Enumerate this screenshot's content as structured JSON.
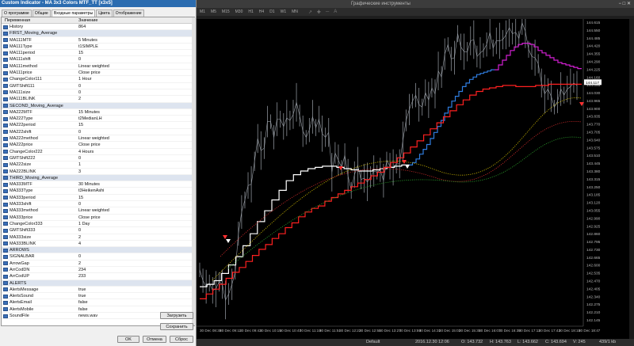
{
  "dialog": {
    "title": "Custom Indicator - MA 3x3 Colors MTF_TT [x3x5]",
    "tabs": [
      "О программе",
      "Общие",
      "Входные параметры",
      "Цвета",
      "Отображение"
    ],
    "active_tab": 2,
    "columns": {
      "name": "Переменная",
      "value": "Значение"
    },
    "params": [
      {
        "name": "History",
        "value": "864"
      },
      {
        "name": "FIRST_Moving_Average",
        "value": "",
        "sep": true
      },
      {
        "name": "MA111MTF",
        "value": "5 Minutes"
      },
      {
        "name": "MA111Type",
        "value": "t1SIMPLE"
      },
      {
        "name": "MA111period",
        "value": "15"
      },
      {
        "name": "MA111shift",
        "value": "0"
      },
      {
        "name": "MA111method",
        "value": "Linear weighted"
      },
      {
        "name": "MA111price",
        "value": "Close price"
      },
      {
        "name": "ChangeColor111",
        "value": "1 Hour"
      },
      {
        "name": "GMTShift111",
        "value": "0"
      },
      {
        "name": "MA111size",
        "value": "0"
      },
      {
        "name": "MA111BLINK",
        "value": "2"
      },
      {
        "name": "SECOND_Moving_Average",
        "value": "",
        "sep": true
      },
      {
        "name": "MA222MTF",
        "value": "15 Minutes"
      },
      {
        "name": "MA222Type",
        "value": "t2MedianLH"
      },
      {
        "name": "MA222period",
        "value": "15"
      },
      {
        "name": "MA222shift",
        "value": "0"
      },
      {
        "name": "MA222method",
        "value": "Linear weighted"
      },
      {
        "name": "MA222price",
        "value": "Close price"
      },
      {
        "name": "ChangeColor222",
        "value": "4 Hours"
      },
      {
        "name": "GMTShift222",
        "value": "0"
      },
      {
        "name": "MA222size",
        "value": "1"
      },
      {
        "name": "MA222BLINK",
        "value": "3"
      },
      {
        "name": "THIRD_Moving_Average",
        "value": "",
        "sep": true
      },
      {
        "name": "MA333MTF",
        "value": "30 Minutes"
      },
      {
        "name": "MA333Type",
        "value": "t3HeikenAshi"
      },
      {
        "name": "MA333period",
        "value": "15"
      },
      {
        "name": "MA333shift",
        "value": "0"
      },
      {
        "name": "MA333method",
        "value": "Linear weighted"
      },
      {
        "name": "MA333price",
        "value": "Close price"
      },
      {
        "name": "ChangeColor333",
        "value": "1 Day"
      },
      {
        "name": "GMTShift333",
        "value": "0"
      },
      {
        "name": "MA333size",
        "value": "2"
      },
      {
        "name": "MA333BLINK",
        "value": "4"
      },
      {
        "name": "ARROWS",
        "value": "",
        "sep": true
      },
      {
        "name": "SIGNALBAR",
        "value": "0"
      },
      {
        "name": "ArrowGap",
        "value": "2"
      },
      {
        "name": "ArrCodDN",
        "value": "234"
      },
      {
        "name": "ArrCodUP",
        "value": "233"
      },
      {
        "name": "ALERTS",
        "value": "",
        "sep": true
      },
      {
        "name": "AlertsMessage",
        "value": "true"
      },
      {
        "name": "AlertsSound",
        "value": "true"
      },
      {
        "name": "AlertsEmail",
        "value": "false"
      },
      {
        "name": "AlertsMobile",
        "value": "false"
      },
      {
        "name": "SoundFile",
        "value": "news.wav"
      }
    ],
    "buttons": {
      "load": "Загрузить",
      "save": "Сохранить",
      "ok": "OK",
      "cancel": "Отмена",
      "reset": "Сброс"
    }
  },
  "window": {
    "title": "Графические инструменты",
    "timeframes": [
      "M1",
      "M5",
      "M15",
      "M30",
      "H1",
      "H4",
      "D1",
      "W1",
      "MN"
    ]
  },
  "chart_data": {
    "type": "line",
    "y_ticks": [
      "144.615",
      "144.550",
      "144.485",
      "144.420",
      "144.355",
      "144.290",
      "144.225",
      "144.160",
      "144.095",
      "144.030",
      "143.965",
      "143.900",
      "143.835",
      "143.770",
      "143.705",
      "143.640",
      "143.575",
      "143.510",
      "143.445",
      "143.380",
      "143.315",
      "143.250",
      "143.185",
      "143.120",
      "143.055",
      "142.990",
      "142.925",
      "142.860",
      "142.795",
      "142.730",
      "142.665",
      "142.600",
      "142.535",
      "142.470",
      "142.405",
      "142.340",
      "142.275",
      "142.210",
      "142.145"
    ],
    "price_label": "144.117",
    "x_ticks": [
      "30 Dec 08:39",
      "30 Dec 09:11",
      "30 Dec 09:43",
      "30 Dec 10:15",
      "30 Dec 10:47",
      "30 Dec 11:19",
      "30 Dec 11:51",
      "30 Dec 12:23",
      "30 Dec 12:55",
      "30 Dec 13:27",
      "30 Dec 13:59",
      "30 Dec 14:31",
      "30 Dec 15:03",
      "30 Dec 15:35",
      "30 Dec 16:07",
      "30 Dec 16:39",
      "30 Dec 17:11",
      "30 Dec 17:43",
      "30 Dec 18:15",
      "30 Dec 18:47"
    ],
    "price": [
      142.56,
      142.47,
      142.42,
      142.45,
      142.39,
      142.4,
      142.46,
      142.44,
      142.31,
      142.36,
      142.44,
      142.54,
      142.86,
      143.04,
      143.14,
      143.26,
      143.27,
      143.46,
      143.65,
      143.55,
      143.57,
      143.79,
      143.79,
      143.66,
      143.81,
      143.81,
      143.75,
      143.82,
      143.8,
      143.85,
      143.95,
      143.84,
      143.71,
      143.66,
      143.72,
      143.83,
      143.74,
      143.81,
      143.69,
      143.66,
      143.7,
      143.37,
      143.53,
      143.47,
      143.41,
      143.51,
      143.34,
      143.22,
      143.35,
      143.43,
      143.31,
      143.32,
      143.29,
      143.33,
      143.38,
      143.37,
      143.39,
      143.3,
      143.47,
      143.42,
      143.41,
      143.44,
      143.44,
      143.63,
      143.8,
      143.89,
      143.96,
      144.01,
      143.93,
      143.91,
      144.03,
      143.97,
      144.07,
      144.02,
      144.21,
      144.16,
      144.35,
      144.43,
      144.31,
      144.32,
      144.52,
      144.41,
      144.37,
      144.37,
      144.46,
      144.47,
      144.33,
      144.36,
      144.38,
      144.43,
      144.53,
      144.4,
      144.46,
      144.46,
      144.47,
      144.51,
      144.57,
      144.52,
      144.53,
      144.48,
      144.61,
      144.54,
      144.39,
      144.33,
      144.32,
      144.27,
      144.11,
      144.02,
      144.06,
      144.0,
      143.91,
      143.96,
      144.06,
      144.01,
      144.06,
      144.08,
      144.11,
      144.09
    ],
    "series": [
      {
        "color": "#ffffff",
        "line": "step",
        "values": [
          142.42,
          142.42,
          142.44,
          142.44,
          142.47,
          142.47,
          142.53,
          142.53,
          142.6,
          142.6,
          142.67,
          142.67,
          142.76,
          142.76,
          142.86,
          142.86,
          142.96,
          142.96,
          143.05,
          143.05,
          143.14,
          143.14,
          143.22,
          143.22,
          143.3,
          143.3,
          143.35,
          143.35,
          143.38,
          143.38,
          143.4,
          143.4,
          143.41,
          143.41,
          143.42,
          143.42,
          143.42,
          143.42,
          143.41,
          143.41,
          143.4,
          143.4,
          143.39,
          143.39,
          143.38,
          143.38,
          143.38,
          143.38,
          143.39,
          143.39,
          143.4,
          143.4,
          143.41,
          143.41,
          143.42,
          143.42,
          143.43,
          143.43
        ]
      },
      {
        "color": "#2f7de0",
        "line": "step",
        "values": [
          143.43,
          143.45,
          143.48,
          143.52,
          143.56,
          143.6,
          143.65,
          143.7,
          143.75,
          143.8,
          143.86,
          143.91,
          143.96,
          144.0,
          144.04,
          144.08,
          144.11,
          144.14,
          144.16,
          144.18,
          144.19,
          144.2,
          144.21,
          144.22
        ]
      },
      {
        "color": "#d21fd2",
        "line": "step",
        "values": [
          144.22,
          144.26,
          144.3,
          144.34,
          144.38,
          144.41,
          144.43,
          144.44,
          144.44,
          144.43,
          144.41,
          144.38,
          144.36,
          144.34,
          144.32,
          144.3,
          144.28,
          144.27,
          144.26,
          144.25,
          144.24,
          144.23
        ]
      },
      {
        "color": "#ff2020",
        "line": "step",
        "values": [
          142.32,
          142.36,
          142.4,
          142.44,
          142.49,
          142.54,
          142.58,
          142.63,
          142.68,
          142.73,
          142.77,
          142.82,
          142.86,
          142.91,
          142.95,
          143.0,
          143.04,
          143.07,
          143.09,
          143.13,
          143.16,
          143.19,
          143.22,
          143.25,
          143.28,
          143.31,
          143.34,
          143.37,
          143.41,
          143.45,
          143.49,
          143.53,
          143.58,
          143.63,
          143.68,
          143.73,
          143.78,
          143.83,
          143.88,
          143.93,
          143.97,
          144.01,
          144.04,
          144.06,
          144.07,
          144.08,
          144.09,
          144.09,
          144.08,
          144.08,
          144.08,
          144.09,
          144.09,
          144.1,
          144.1,
          144.1,
          144.1,
          144.1
        ]
      }
    ]
  },
  "status": {
    "profile": "Default",
    "datetime": "2016.12.30 12:06",
    "o": "O: 143.732",
    "h": "H: 143.763",
    "l": "L: 143.662",
    "c": "C: 143.694",
    "v": "V: 245",
    "traffic": "439/1 kb"
  }
}
